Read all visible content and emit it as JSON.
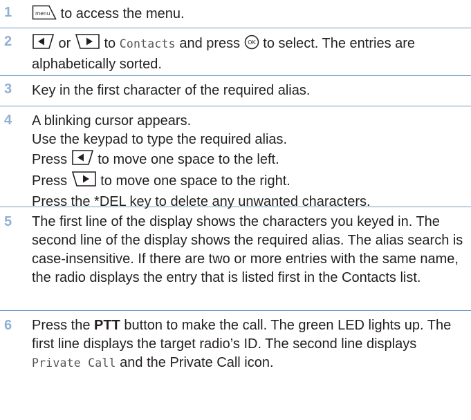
{
  "steps": [
    {
      "num": "1",
      "menu_key": "menu",
      "t1": " to access the menu."
    },
    {
      "num": "2",
      "or": " or ",
      "to": " to ",
      "screen_contacts": "Contacts",
      "press": " and press ",
      "ok_key": "OK",
      "rest": " to select. The entries are alphabetically sorted."
    },
    {
      "num": "3",
      "text": "Key in the first character of the required alias."
    },
    {
      "num": "4",
      "l1": "A blinking cursor appears.",
      "l2": "Use the keypad to type the required alias.",
      "l3a": "Press ",
      "l3b": " to move one space to the left.",
      "l4a": "Press ",
      "l4b": " to move one space to the right.",
      "l5": "Press the *DEL key to delete any unwanted characters."
    },
    {
      "num": "5",
      "text": "The first line of the display shows the characters you keyed in. The second line of the display shows the required alias. The alias search is case-insensitive. If there are two or more entries with the same name, the radio displays the entry that is listed first in the Contacts list."
    },
    {
      "num": "6",
      "a": "Press the ",
      "ptt": "PTT",
      "b": " button to make the call. The green LED lights up. The first line displays the target radio’s ID. The second line displays ",
      "screen_private": "Private Call",
      "c": " and the Private Call icon."
    }
  ]
}
